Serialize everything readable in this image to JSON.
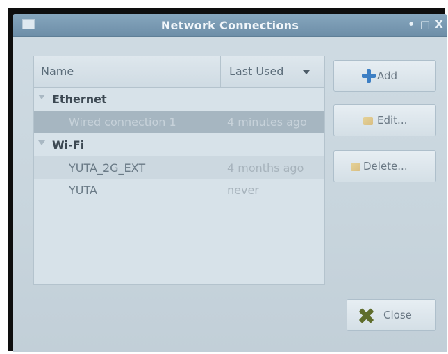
{
  "window": {
    "title": "Network Connections",
    "controls": {
      "minimize": "•",
      "maximize": "□",
      "close": "X"
    }
  },
  "list": {
    "columns": {
      "name": "Name",
      "last_used": "Last Used"
    },
    "groups": [
      {
        "label": "Ethernet",
        "connections": [
          {
            "name": "Wired connection 1",
            "last_used": "4 minutes ago",
            "selected": true
          }
        ]
      },
      {
        "label": "Wi-Fi",
        "connections": [
          {
            "name": "YUTA_2G_EXT",
            "last_used": "4 months ago",
            "selected": false
          },
          {
            "name": "YUTA",
            "last_used": "never",
            "selected": false
          }
        ]
      }
    ]
  },
  "buttons": {
    "add": "Add",
    "edit": "Edit...",
    "delete": "Delete...",
    "close": "Close"
  },
  "icons": {
    "add": "plus-icon",
    "edit": "edit-icon",
    "delete": "delete-icon",
    "close": "close-icon",
    "sort": "chevron-down-icon",
    "app": "network-icon"
  },
  "colors": {
    "titlebar": "#7f9fb6",
    "window_bg": "#cbd7df",
    "selection": "#a6b6c1",
    "add_icon": "#3d7fc4"
  }
}
